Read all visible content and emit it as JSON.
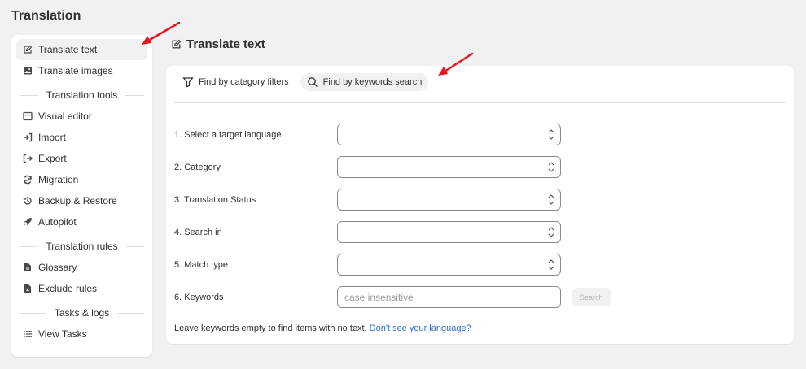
{
  "page": {
    "title": "Translation"
  },
  "sidebar": {
    "items_top": [
      {
        "label": "Translate text",
        "icon": "edit-icon",
        "active": true
      },
      {
        "label": "Translate images",
        "icon": "image-icon"
      }
    ],
    "sections": [
      {
        "title": "Translation tools",
        "items": [
          {
            "label": "Visual editor",
            "icon": "window-icon"
          },
          {
            "label": "Import",
            "icon": "import-icon"
          },
          {
            "label": "Export",
            "icon": "export-icon"
          },
          {
            "label": "Migration",
            "icon": "refresh-icon"
          },
          {
            "label": "Backup & Restore",
            "icon": "history-icon"
          },
          {
            "label": "Autopilot",
            "icon": "rocket-icon"
          }
        ]
      },
      {
        "title": "Translation rules",
        "items": [
          {
            "label": "Glossary",
            "icon": "document-icon"
          },
          {
            "label": "Exclude rules",
            "icon": "file-exclude-icon"
          }
        ]
      },
      {
        "title": "Tasks & logs",
        "items": [
          {
            "label": "View Tasks",
            "icon": "list-icon"
          }
        ]
      }
    ]
  },
  "main": {
    "title": "Translate text",
    "tabs": [
      {
        "label": "Find by category filters",
        "icon": "filter-icon",
        "active": false
      },
      {
        "label": "Find by keywords search",
        "icon": "search-icon",
        "active": true
      }
    ],
    "form": {
      "target_language_label": "1. Select a target language",
      "category_label": "2. Category",
      "status_label": "3. Translation Status",
      "search_in_label": "4. Search in",
      "match_type_label": "5. Match type",
      "keywords_label": "6. Keywords",
      "keywords_placeholder": "case insensitive",
      "keywords_value": "",
      "search_button": "Search"
    },
    "footnote": {
      "text": "Leave keywords empty to find items with no text.",
      "link": "Don't see your language?"
    }
  },
  "colors": {
    "link": "#2c6ecb",
    "annotation_arrow": "#e8171f",
    "active_bg": "#f1f1f1"
  }
}
